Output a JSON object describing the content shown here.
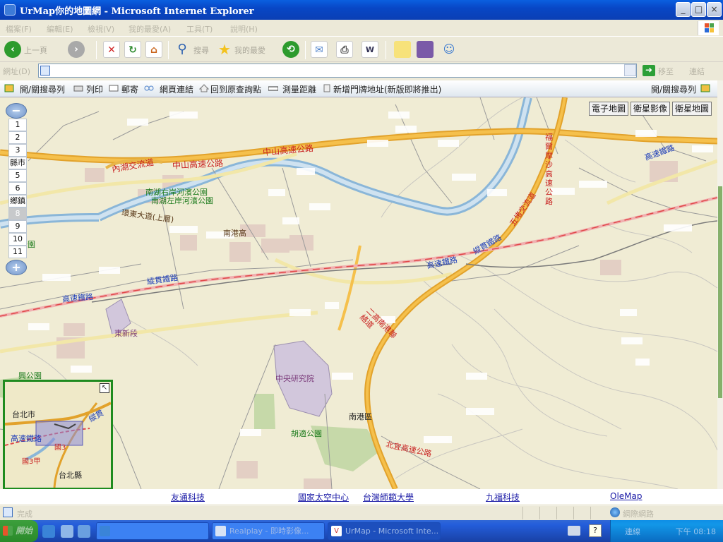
{
  "window": {
    "title": "UrMap你的地圖網 - Microsoft Internet Explorer",
    "minimize": "_",
    "maximize": "□",
    "close": "×"
  },
  "menubar": {
    "items": [
      "檔案(F)",
      "編輯(E)",
      "檢視(V)",
      "我的最愛(A)",
      "工具(T)",
      "說明(H)"
    ]
  },
  "toolbar": {
    "back_label": "上一頁",
    "search_label": "搜尋",
    "favorites_label": "我的最愛"
  },
  "address": {
    "label": "網址(D)",
    "value": "",
    "go_label": "移至",
    "links_label": "連結"
  },
  "mapbar": {
    "toggle_search_left": "開/關搜尋列",
    "print": "列印",
    "mail": "郵寄",
    "page_link": "網頁連結",
    "back_to_query": "回到原查詢點",
    "measure": "測量距離",
    "add_address": "新增門牌地址(新版即將推出)",
    "toggle_search_right": "開/關搜尋列"
  },
  "map_views": {
    "electronic": "電子地圖",
    "satellite": "衛星影像",
    "satellite_map": "衛星地圖"
  },
  "zoom": {
    "levels": [
      "1",
      "2",
      "3",
      "縣市",
      "5",
      "6",
      "鄉鎮",
      "8",
      "9",
      "10",
      "11"
    ],
    "selected": "8",
    "zoom_out": "−",
    "zoom_in": "+"
  },
  "map_labels": {
    "hw_zhongshan_1": "中山高速公路",
    "hw_zhongshan_2": "中山高速公路",
    "neihu_interchange": "內湖交流道",
    "park_1": "南湖右岸河濱公園",
    "park_2": "南湖左岸河濱公園",
    "huandong": "環東大道(上層)",
    "nangang_high": "南港高",
    "longitudinal_1": "縱貫鐵路",
    "longitudinal_2": "縱貫鐵路",
    "highspeed_1": "高速鐵路",
    "highspeed_2": "高速鐵路",
    "highspeed_3": "高速鐵路",
    "east_xinzhuang": "東新段",
    "academia": "中央研究院",
    "nangang_district": "南港區",
    "hushi_park": "胡適公園",
    "second_highway": "二高南港聯絡道",
    "beiyi": "北宜高速公路",
    "wufu_interchange": "五堵交流道",
    "fulong_hw": "福爾摩沙高速公路",
    "liushou_park": "公園",
    "xinghua_park": "興公園"
  },
  "overview": {
    "expand": "↖",
    "label_taipei_city": "台北市",
    "label_highspeed": "高速鐵路",
    "label_longitudinal": "縱貫",
    "label_taipei_county": "台北縣",
    "label_road3": "國3",
    "label_road3a": "國3甲"
  },
  "footer": {
    "links": [
      "友通科技",
      "國家太空中心",
      "台灣師範大學",
      "九福科技",
      "OleMap"
    ]
  },
  "status": {
    "text": "完成",
    "zone": "網際網路"
  },
  "taskbar": {
    "start": "開始",
    "tasks": [
      "",
      "Realplay - 即時影像...",
      "UrMap - Microsoft Inte..."
    ],
    "help": "?",
    "tray_label": "連線",
    "clock": "下午 08:18"
  }
}
